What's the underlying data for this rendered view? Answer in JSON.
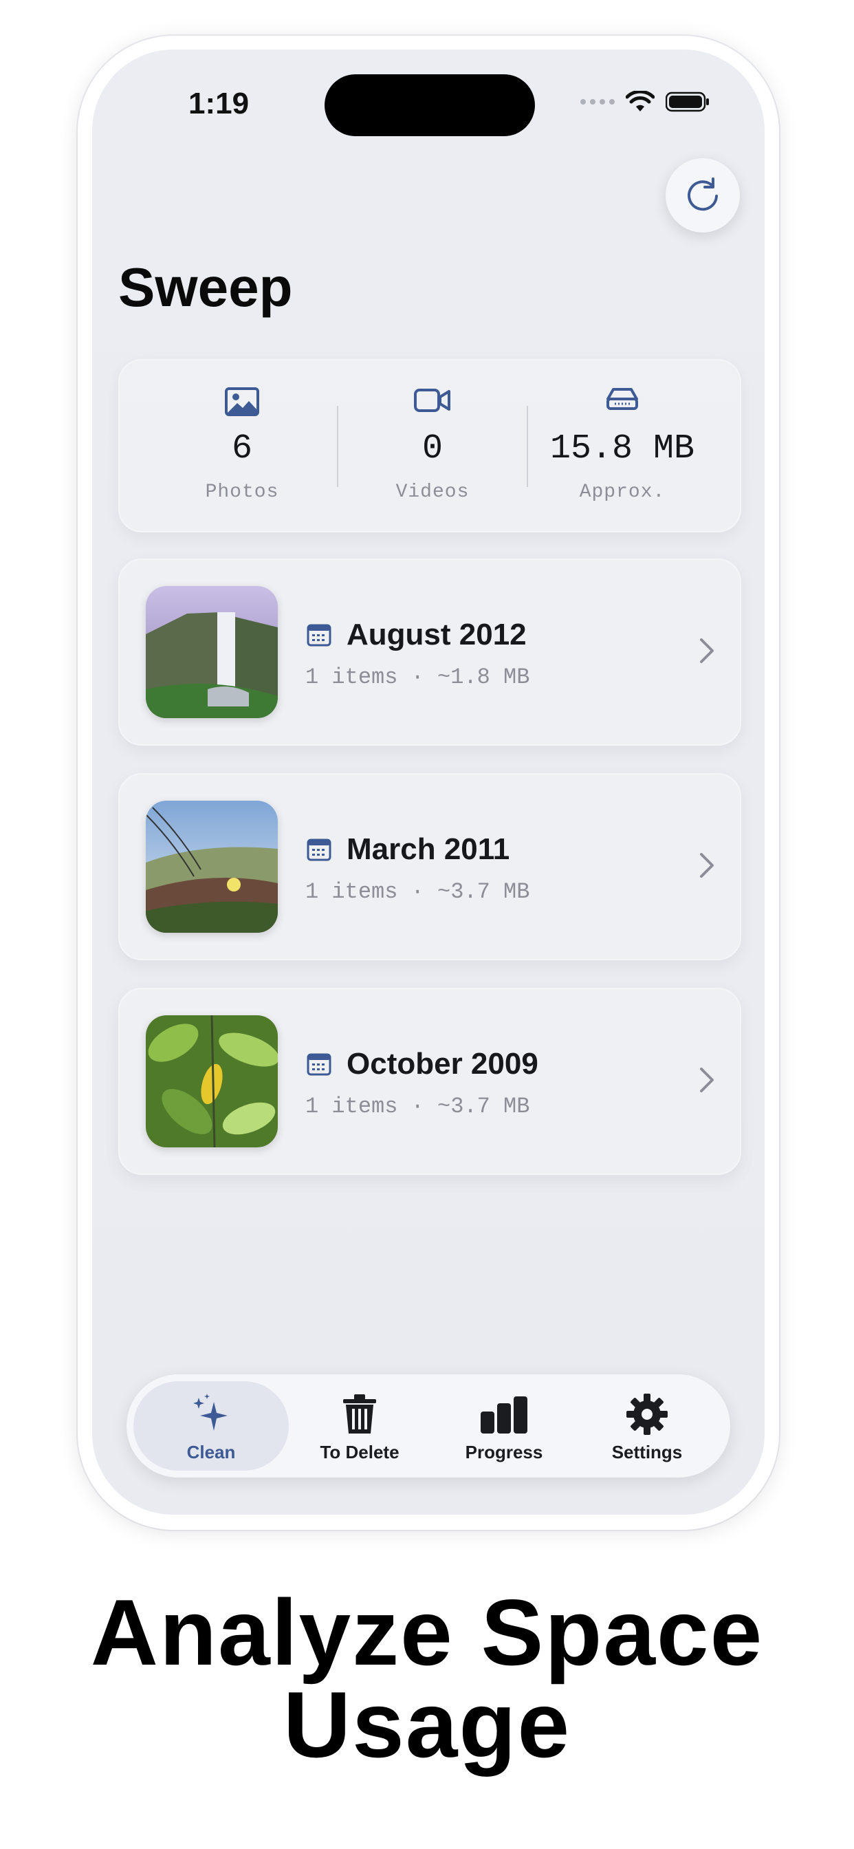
{
  "status_bar": {
    "time": "1:19"
  },
  "app": {
    "title": "Sweep"
  },
  "stats": [
    {
      "icon": "photo-icon",
      "value": "6",
      "label": "Photos"
    },
    {
      "icon": "video-icon",
      "value": "0",
      "label": "Videos"
    },
    {
      "icon": "storage-drive-icon",
      "value": "15.8 MB",
      "label": "Approx."
    }
  ],
  "albums": [
    {
      "title": "August 2012",
      "subtitle": "1 items · ~1.8 MB",
      "thumbnail": "waterfall photo"
    },
    {
      "title": "March 2011",
      "subtitle": "1 items · ~3.7 MB",
      "thumbnail": "coastal flowers photo"
    },
    {
      "title": "October 2009",
      "subtitle": "1 items · ~3.7 MB",
      "thumbnail": "green leaves photo"
    }
  ],
  "tabbar": {
    "active": "Clean",
    "tabs": [
      {
        "label": "Clean",
        "icon": "sparkles-icon"
      },
      {
        "label": "To Delete",
        "icon": "trash-icon"
      },
      {
        "label": "Progress",
        "icon": "bar-chart-icon"
      },
      {
        "label": "Settings",
        "icon": "gear-icon"
      }
    ]
  },
  "caption": {
    "line1": "Analyze Space",
    "line2": "Usage"
  },
  "colors": {
    "accent": "#3d5a95",
    "background": "#ebedf3",
    "card": "#f0f1f5"
  }
}
